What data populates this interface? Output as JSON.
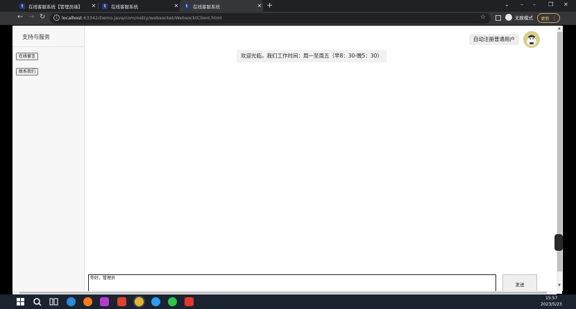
{
  "browser": {
    "tabs": [
      {
        "title": "在线客服系统【管理员端】",
        "favicon": "IJ"
      },
      {
        "title": "在线客服系统",
        "favicon": "IJ"
      },
      {
        "title": "在线客服系统",
        "favicon": "IJ"
      }
    ],
    "active_tab_index": 2,
    "new_tab_label": "+",
    "url_host": "localhost",
    "url_rest": ":63342/Demo.Java/com/netty/websocket/WebsocktClient.html",
    "incognito_label": "无痕模式",
    "update_label": "更新"
  },
  "sidebar": {
    "title": "支持与服务",
    "buttons": [
      "在线留言",
      "联系我们"
    ]
  },
  "chat": {
    "user_label": "自动注册普通用户",
    "welcome": "欢迎光临，我们工作时间：周一至周五（早8：30-晚5：30）",
    "input_value": "你好，管理员",
    "send_label": "发送"
  },
  "taskbar": {
    "time": "15:57",
    "date": "2023/5/23"
  },
  "colors": {
    "tab_bg": "#202124",
    "toolbar_bg": "#35363a",
    "update_accent": "#f2c46d",
    "taskbar_bg": "#1c2330"
  }
}
